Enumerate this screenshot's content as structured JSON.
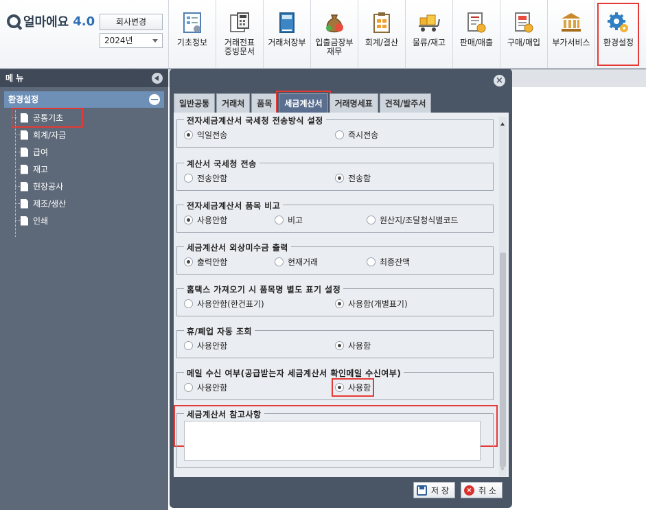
{
  "app": {
    "logo_text": "얼마에요",
    "logo_version": "4.0"
  },
  "header": {
    "company_button": "회사변경",
    "year_value": "2024년"
  },
  "toolbar": [
    {
      "id": "basic-info",
      "label": "기초정보",
      "icon": "form-icon"
    },
    {
      "id": "voucher",
      "label": "거래전표\n증빙문서",
      "icon": "calculator-icon"
    },
    {
      "id": "ledger",
      "label": "거래처장부",
      "icon": "book-icon"
    },
    {
      "id": "cash",
      "label": "입출금장부\n재무",
      "icon": "moneybag-icon"
    },
    {
      "id": "accounting",
      "label": "회계/결산",
      "icon": "clipboard-icon"
    },
    {
      "id": "logistics",
      "label": "물류/재고",
      "icon": "cart-icon"
    },
    {
      "id": "sales",
      "label": "판매/매출",
      "icon": "sales-doc-icon"
    },
    {
      "id": "purchase",
      "label": "구매/매입",
      "icon": "receipt-icon"
    },
    {
      "id": "addon",
      "label": "부가서비스",
      "icon": "bank-icon"
    },
    {
      "id": "settings",
      "label": "환경설정",
      "icon": "gear-icon"
    }
  ],
  "menu": {
    "title": "메 뉴",
    "section": "환경설정",
    "items": [
      "공통기초",
      "회계/자금",
      "급여",
      "재고",
      "현장공사",
      "제조/생산",
      "인쇄"
    ]
  },
  "dialog": {
    "close": "×",
    "tabs": [
      "일반공통",
      "거래처",
      "품목",
      "세금계산서",
      "거래명세표",
      "견적/발주서"
    ],
    "active_tab": "세금계산서",
    "groups": [
      {
        "title": "전자세금계산서 국세청 전송방식 설정",
        "options": [
          "익일전송",
          "즉시전송"
        ],
        "checked": 0
      },
      {
        "title": "계산서 국세청 전송",
        "options": [
          "전송안함",
          "전송함"
        ],
        "checked": 1
      },
      {
        "title": "전자세금계산서 품목 비고",
        "options": [
          "사용안함",
          "비고",
          "원산지/조달청식별코드"
        ],
        "checked": 0
      },
      {
        "title": "세금계산서 외상미수금 출력",
        "options": [
          "출력안함",
          "현재거래",
          "최종잔액"
        ],
        "checked": 0
      },
      {
        "title": "홈택스 가져오기 시 품목명 별도 표기 설정",
        "options": [
          "사용안함(한건표기)",
          "사용함(개별표기)"
        ],
        "checked": 1
      },
      {
        "title": "휴/폐업 자동 조회",
        "options": [
          "사용안함",
          "사용함"
        ],
        "checked": 1
      },
      {
        "title": "메일 수신 여부(공급받는자 세금계산서 확인메일 수신여부)",
        "options": [
          "사용안함",
          "사용함"
        ],
        "checked": 1
      }
    ],
    "notes_title": "세금계산서 참고사항",
    "notes_value": "",
    "save_label": "저 장",
    "cancel_label": "취 소"
  },
  "colors": {
    "highlight": "#e53935",
    "menu_bg": "#5d6978",
    "dialog_bg": "#4a5566",
    "active_tab": "#5a6f90"
  }
}
